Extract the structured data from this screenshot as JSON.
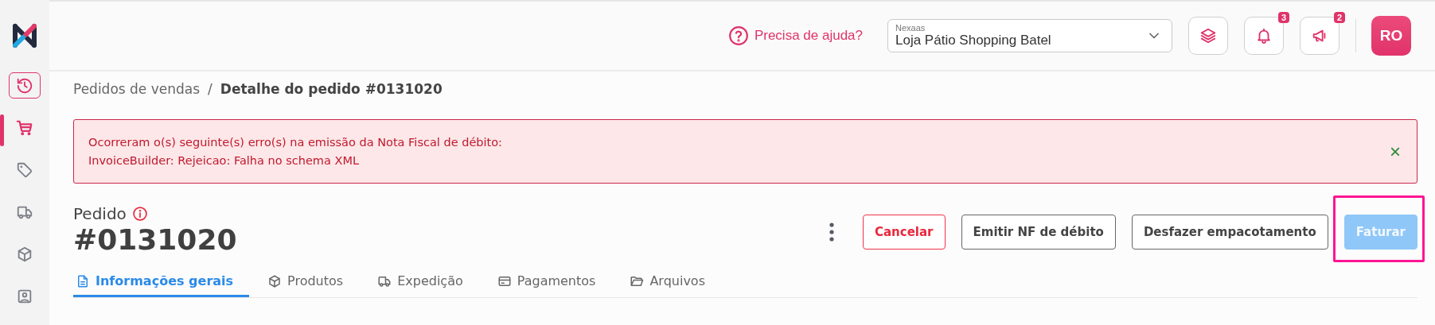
{
  "sidebar": {
    "items": [
      {
        "selected": false,
        "outlined": true
      },
      {
        "selected": true,
        "outlined": false
      },
      {
        "selected": false,
        "outlined": false
      },
      {
        "selected": false,
        "outlined": false
      },
      {
        "selected": false,
        "outlined": false
      },
      {
        "selected": false,
        "outlined": false
      }
    ]
  },
  "topbar": {
    "help": "Precisa de ajuda?",
    "store_select": {
      "label": "Nexaas",
      "value": "Loja Pátio Shopping Batel"
    },
    "notifications_badge": "3",
    "announcements_badge": "2",
    "avatar": "RO"
  },
  "breadcrumb": [
    {
      "label": "Pedidos de vendas",
      "current": false
    },
    {
      "label": "Detalhe do pedido #0131020",
      "current": true
    }
  ],
  "separator": "/",
  "alert": {
    "lines": [
      "Ocorreram o(s) seguinte(s) erro(s) na emissão da Nota Fiscal de débito:",
      "InvoiceBuilder: Rejeicao: Falha no schema XML"
    ],
    "close": "×"
  },
  "order": {
    "label": "Pedido",
    "number": "#0131020"
  },
  "actions": [
    {
      "label": "Cancelar",
      "kind": "danger",
      "disabled": false,
      "highlighted": false
    },
    {
      "label": "Emitir NF de débito",
      "kind": "outline",
      "disabled": false,
      "highlighted": false
    },
    {
      "label": "Desfazer empacotamento",
      "kind": "outline",
      "disabled": false,
      "highlighted": false
    },
    {
      "label": "Faturar",
      "kind": "primary",
      "disabled": true,
      "highlighted": true
    }
  ],
  "tabs": [
    {
      "label": "Informações gerais",
      "selected": true
    },
    {
      "label": "Produtos",
      "selected": false
    },
    {
      "label": "Expedição",
      "selected": false
    },
    {
      "label": "Pagamentos",
      "selected": false
    },
    {
      "label": "Arquivos",
      "selected": false
    }
  ]
}
